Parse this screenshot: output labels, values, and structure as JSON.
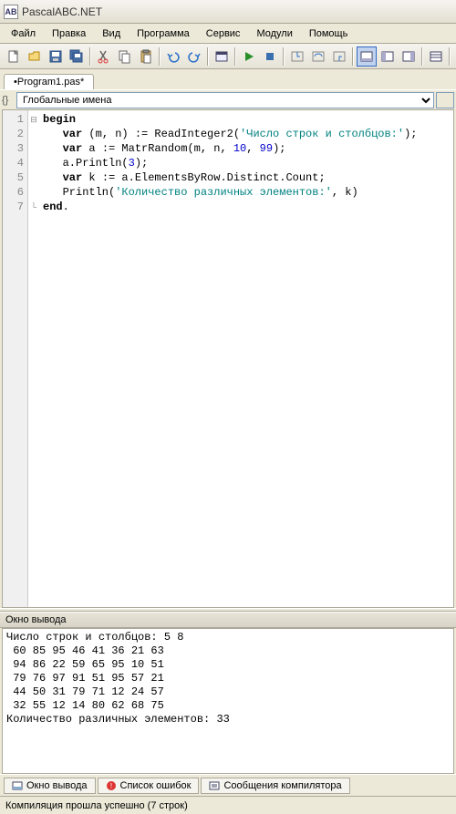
{
  "window": {
    "title": "PascalABC.NET"
  },
  "menus": [
    "Файл",
    "Правка",
    "Вид",
    "Программа",
    "Сервис",
    "Модули",
    "Помощь"
  ],
  "tabs": {
    "active": "•Program1.pas*"
  },
  "scope": {
    "selected": "Глобальные имена"
  },
  "code": {
    "lines": [
      1,
      2,
      3,
      4,
      5,
      6,
      7
    ],
    "tokens": [
      [
        {
          "t": "kw",
          "v": "begin"
        }
      ],
      [
        {
          "t": "pl",
          "v": "   "
        },
        {
          "t": "kw",
          "v": "var"
        },
        {
          "t": "pl",
          "v": " (m, n) := ReadInteger2("
        },
        {
          "t": "str",
          "v": "'Число строк и столбцов:'"
        },
        {
          "t": "pl",
          "v": ");"
        }
      ],
      [
        {
          "t": "pl",
          "v": "   "
        },
        {
          "t": "kw",
          "v": "var"
        },
        {
          "t": "pl",
          "v": " a := MatrRandom(m, n, "
        },
        {
          "t": "num",
          "v": "10"
        },
        {
          "t": "pl",
          "v": ", "
        },
        {
          "t": "num",
          "v": "99"
        },
        {
          "t": "pl",
          "v": ");"
        }
      ],
      [
        {
          "t": "pl",
          "v": "   a.Println("
        },
        {
          "t": "num",
          "v": "3"
        },
        {
          "t": "pl",
          "v": ");"
        }
      ],
      [
        {
          "t": "pl",
          "v": "   "
        },
        {
          "t": "kw",
          "v": "var"
        },
        {
          "t": "pl",
          "v": " k := a.ElementsByRow.Distinct.Count;"
        }
      ],
      [
        {
          "t": "pl",
          "v": "   Println("
        },
        {
          "t": "str",
          "v": "'Количество различных элементов:'"
        },
        {
          "t": "pl",
          "v": ", k)"
        }
      ],
      [
        {
          "t": "kw",
          "v": "end"
        },
        {
          "t": "pl",
          "v": "."
        }
      ]
    ]
  },
  "output": {
    "title": "Окно вывода",
    "text": "Число строк и столбцов: 5 8\n 60 85 95 46 41 36 21 63\n 94 86 22 59 65 95 10 51\n 79 76 97 91 51 95 57 21\n 44 50 31 79 71 12 24 57\n 32 55 12 14 80 62 68 75\nКоличество различных элементов: 33"
  },
  "bottom_tabs": [
    "Окно вывода",
    "Список ошибок",
    "Сообщения компилятора"
  ],
  "status": "Компиляция прошла успешно (7 строк)"
}
